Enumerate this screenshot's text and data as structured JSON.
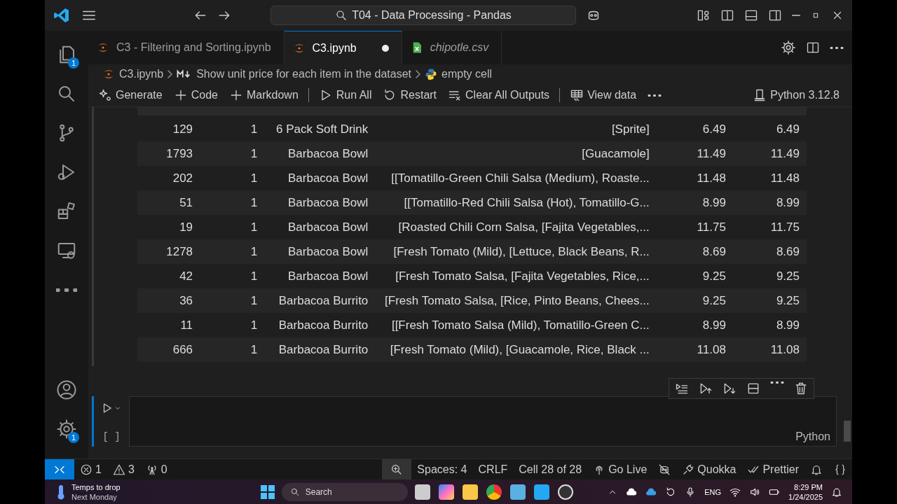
{
  "title_bar": {
    "search": "T04 - Data Processing - Pandas"
  },
  "activity_bar": [
    {
      "kind": "explorer",
      "badge": "1"
    },
    {
      "kind": "search"
    },
    {
      "kind": "source-control"
    },
    {
      "kind": "run-debug"
    },
    {
      "kind": "extensions"
    },
    {
      "kind": "remote"
    },
    {
      "kind": "more"
    }
  ],
  "activity_bar_bottom": [
    {
      "kind": "account"
    },
    {
      "kind": "manage",
      "badge": "1"
    }
  ],
  "tabs": [
    {
      "label": "C3 - Filtering and Sorting.ipynb",
      "kind": "notebook",
      "selected": false,
      "modified": false,
      "preview": false
    },
    {
      "label": "C3.ipynb",
      "kind": "notebook",
      "selected": true,
      "modified": true,
      "preview": false
    },
    {
      "label": "chipotle.csv",
      "kind": "csv",
      "selected": false,
      "modified": false,
      "preview": true
    }
  ],
  "breadcrumb": [
    {
      "kind": "notebook",
      "label": "C3.ipynb"
    },
    {
      "kind": "markdown",
      "label": "Show unit price for each item in the dataset"
    },
    {
      "kind": "python",
      "label": "empty cell"
    }
  ],
  "toolbar": [
    {
      "kind": "generate",
      "label": "Generate"
    },
    {
      "kind": "add",
      "label": "Code"
    },
    {
      "kind": "add",
      "label": "Markdown"
    },
    {
      "kind": "separator"
    },
    {
      "kind": "run-all",
      "label": "Run All"
    },
    {
      "kind": "restart",
      "label": "Restart"
    },
    {
      "kind": "clear",
      "label": "Clear All Outputs"
    },
    {
      "kind": "separator"
    },
    {
      "kind": "view-data",
      "label": "View data"
    },
    {
      "kind": "more"
    }
  ],
  "kernel": "Python 3.12.8",
  "table": {
    "rows": [
      [
        "129",
        "1",
        "6 Pack Soft Drink",
        "[Sprite]",
        "6.49",
        "6.49"
      ],
      [
        "1793",
        "1",
        "Barbacoa Bowl",
        "[Guacamole]",
        "11.49",
        "11.49"
      ],
      [
        "202",
        "1",
        "Barbacoa Bowl",
        "[[Tomatillo-Green Chili Salsa (Medium), Roaste...",
        "11.48",
        "11.48"
      ],
      [
        "51",
        "1",
        "Barbacoa Bowl",
        "[[Tomatillo-Red Chili Salsa (Hot), Tomatillo-G...",
        "8.99",
        "8.99"
      ],
      [
        "19",
        "1",
        "Barbacoa Bowl",
        "[Roasted Chili Corn Salsa, [Fajita Vegetables,...",
        "11.75",
        "11.75"
      ],
      [
        "1278",
        "1",
        "Barbacoa Bowl",
        "[Fresh Tomato (Mild), [Lettuce, Black Beans, R...",
        "8.69",
        "8.69"
      ],
      [
        "42",
        "1",
        "Barbacoa Bowl",
        "[Fresh Tomato Salsa, [Fajita Vegetables, Rice,...",
        "9.25",
        "9.25"
      ],
      [
        "36",
        "1",
        "Barbacoa Burrito",
        "[Fresh Tomato Salsa, [Rice, Pinto Beans, Chees...",
        "9.25",
        "9.25"
      ],
      [
        "11",
        "1",
        "Barbacoa Burrito",
        "[[Fresh Tomato Salsa (Mild), Tomatillo-Green C...",
        "8.99",
        "8.99"
      ],
      [
        "666",
        "1",
        "Barbacoa Burrito",
        "[Fresh Tomato (Mild), [Guacamole, Rice, Black ...",
        "11.08",
        "11.08"
      ]
    ]
  },
  "cell_toolbar": [
    {
      "kind": "run-above"
    },
    {
      "kind": "run-cell-above"
    },
    {
      "kind": "run-cell-below"
    },
    {
      "kind": "split"
    },
    {
      "kind": "more"
    },
    {
      "kind": "delete"
    }
  ],
  "cell": {
    "execution_label": "[ ]",
    "language": "Python"
  },
  "status_bar": {
    "left": [
      {
        "kind": "errors",
        "label": "1"
      },
      {
        "kind": "warnings",
        "label": "3"
      },
      {
        "kind": "ports",
        "label": "0"
      }
    ],
    "right": [
      {
        "kind": "zoom"
      },
      {
        "kind": "text",
        "label": "Spaces: 4"
      },
      {
        "kind": "text",
        "label": "CRLF"
      },
      {
        "kind": "text",
        "label": "Cell 28 of 28"
      },
      {
        "kind": "live",
        "label": "Go Live"
      },
      {
        "kind": "copilot"
      },
      {
        "kind": "plug",
        "label": "Quokka"
      },
      {
        "kind": "check",
        "label": "Prettier"
      },
      {
        "kind": "bell"
      },
      {
        "kind": "braces"
      }
    ]
  },
  "taskbar": {
    "weather_title": "Temps to drop",
    "weather_subtitle": "Next Monday",
    "search": "Search",
    "language": "ENG",
    "time": "8:29 PM",
    "date": "1/24/2025"
  }
}
